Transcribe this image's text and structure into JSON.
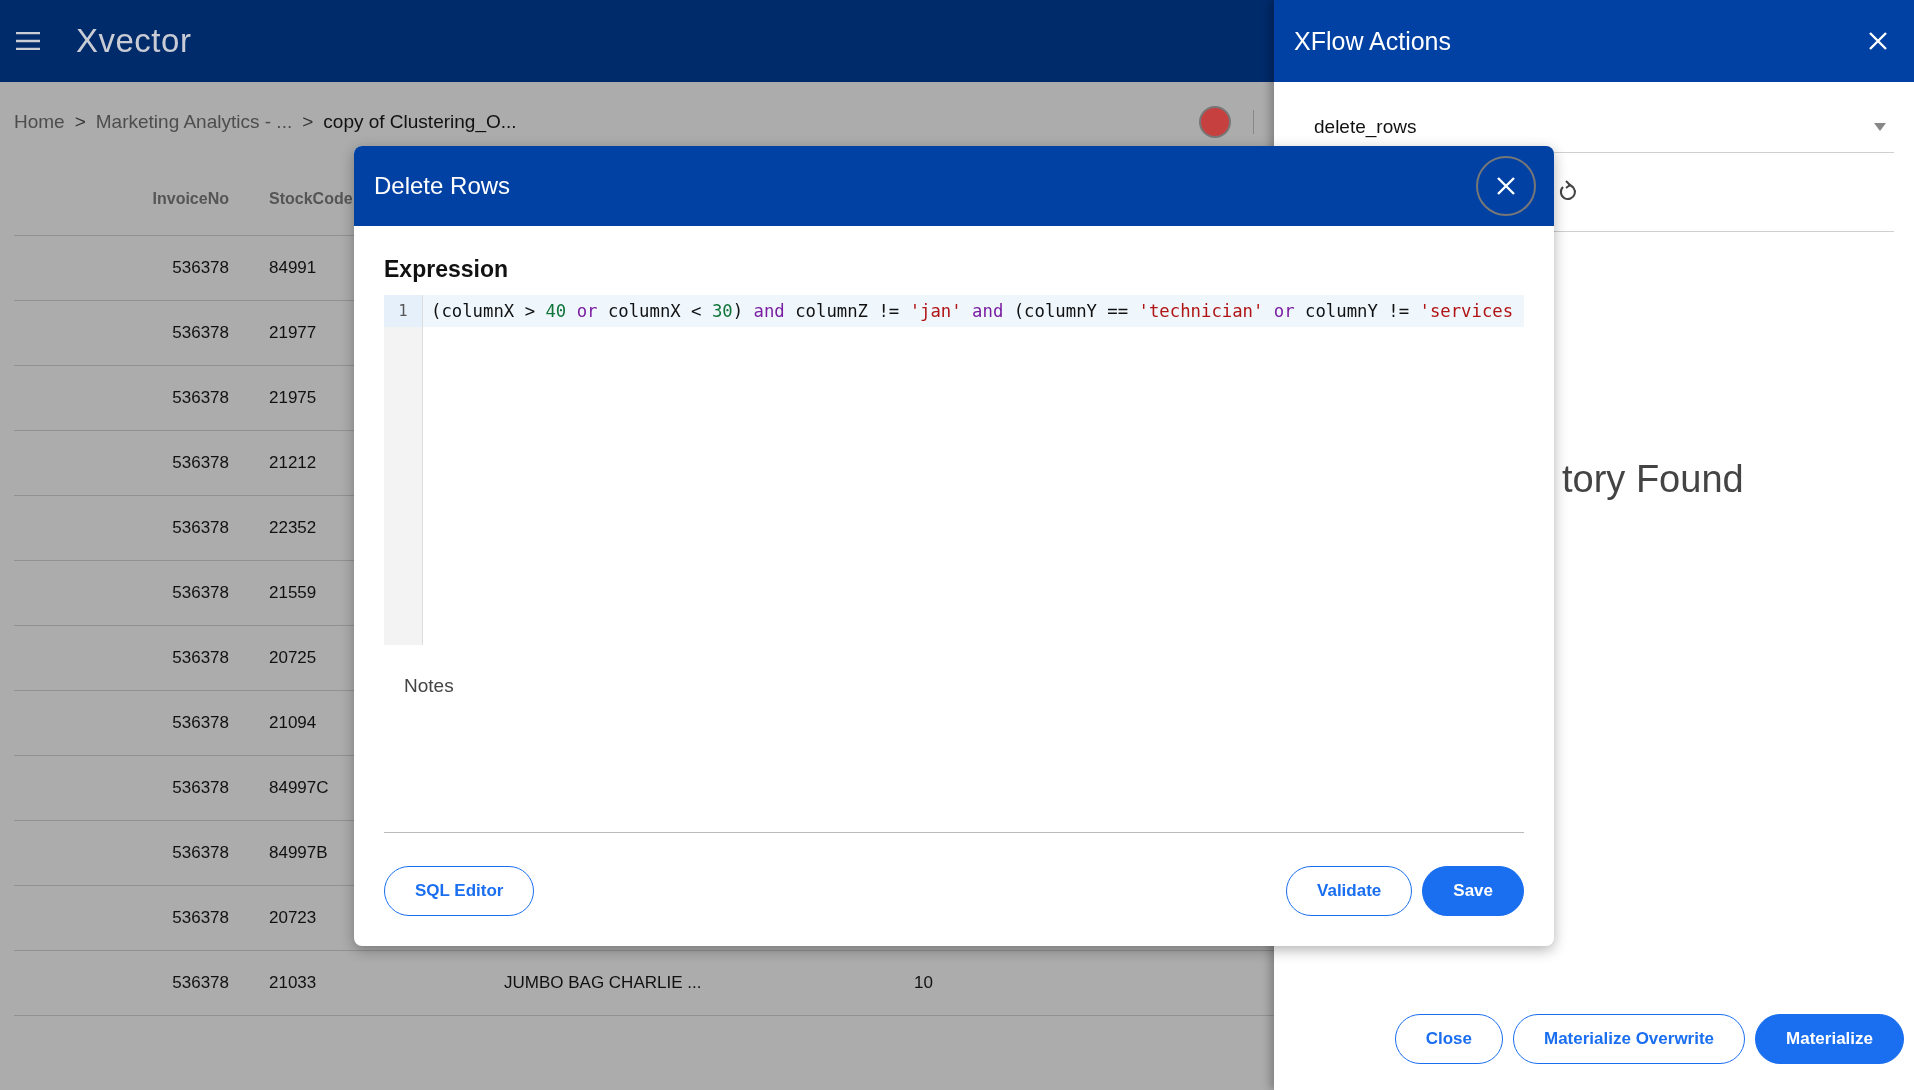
{
  "app_bar": {
    "logo": "Xvector"
  },
  "breadcrumb": {
    "separator": ">",
    "items": [
      {
        "label": "Home",
        "current": false
      },
      {
        "label": "Marketing Analytics - ...",
        "current": false
      },
      {
        "label": "copy of Clustering_O...",
        "current": true
      }
    ]
  },
  "table": {
    "columns": [
      "InvoiceNo",
      "StockCode"
    ],
    "rows": [
      {
        "invoice": "536378",
        "stock_code": "84991"
      },
      {
        "invoice": "536378",
        "stock_code": "21977"
      },
      {
        "invoice": "536378",
        "stock_code": "21975"
      },
      {
        "invoice": "536378",
        "stock_code": "21212"
      },
      {
        "invoice": "536378",
        "stock_code": "22352"
      },
      {
        "invoice": "536378",
        "stock_code": "21559"
      },
      {
        "invoice": "536378",
        "stock_code": "20725"
      },
      {
        "invoice": "536378",
        "stock_code": "21094"
      },
      {
        "invoice": "536378",
        "stock_code": "84997C"
      },
      {
        "invoice": "536378",
        "stock_code": "84997B"
      },
      {
        "invoice": "536378",
        "stock_code": "20723"
      },
      {
        "invoice": "536378",
        "stock_code": "21033",
        "column_3": "JUMBO BAG CHARLIE ...",
        "column_4": "10"
      }
    ]
  },
  "drawer": {
    "title": "XFlow Actions",
    "action_select": "delete_rows",
    "empty_message": "tory Found",
    "buttons": [
      {
        "label": "Close",
        "primary": false
      },
      {
        "label": "Materialize Overwrite",
        "primary": false
      },
      {
        "label": "Materialize",
        "primary": true
      }
    ]
  },
  "dialog": {
    "title": "Delete Rows",
    "expression_label": "Expression",
    "line_number": "1",
    "code_tokens": [
      {
        "kind": "plain",
        "text": "(columnX > "
      },
      {
        "kind": "number",
        "text": "40"
      },
      {
        "kind": "keyword",
        "text": " or"
      },
      {
        "kind": "plain",
        "text": " columnX < "
      },
      {
        "kind": "number",
        "text": "30"
      },
      {
        "kind": "plain",
        "text": ") "
      },
      {
        "kind": "keyword",
        "text": "and"
      },
      {
        "kind": "plain",
        "text": " columnZ != "
      },
      {
        "kind": "string",
        "text": "'jan'"
      },
      {
        "kind": "keyword",
        "text": " and"
      },
      {
        "kind": "plain",
        "text": " (columnY == "
      },
      {
        "kind": "string",
        "text": "'technician'"
      },
      {
        "kind": "keyword",
        "text": " or"
      },
      {
        "kind": "plain",
        "text": " columnY != "
      },
      {
        "kind": "string",
        "text": "'services"
      }
    ],
    "notes_label": "Notes",
    "buttons": [
      {
        "label": "SQL Editor",
        "primary": false
      },
      {
        "label": "Validate",
        "primary": false
      },
      {
        "label": "Save",
        "primary": true
      }
    ]
  }
}
